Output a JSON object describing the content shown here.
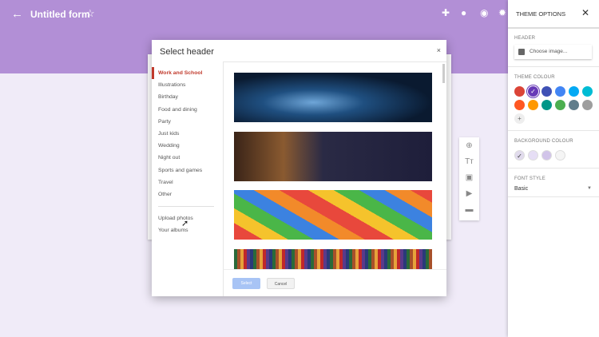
{
  "header": {
    "title": "Untitled form",
    "icons": [
      "back-arrow",
      "star",
      "puzzle",
      "palette",
      "eye",
      "gear"
    ]
  },
  "dialog": {
    "title": "Select header",
    "close": "×",
    "categories": [
      "Work and School",
      "Illustrations",
      "Birthday",
      "Food and dining",
      "Party",
      "Just kids",
      "Wedding",
      "Night out",
      "Sports and games",
      "Travel",
      "Other"
    ],
    "selected": "Work and School",
    "extra": [
      "Upload photos",
      "Your albums"
    ],
    "select_label": "Select",
    "cancel_label": "Cancel"
  },
  "panel": {
    "title": "THEME OPTIONS",
    "close": "✕",
    "header_label": "HEADER",
    "choose_image": "Choose image...",
    "theme_label": "THEME COLOUR",
    "theme_colors": [
      "#db4437",
      "#673ab7",
      "#3f51b5",
      "#4285f4",
      "#03a9f4",
      "#00bcd4",
      "#ff5722",
      "#ff9800",
      "#009688",
      "#4caf50",
      "#607d8b",
      "#9e9e9e"
    ],
    "theme_selected": "#673ab7",
    "background_label": "BACKGROUND COLOUR",
    "background_colors": [
      "#e1dbed",
      "#e6def5",
      "#d1c4e9",
      "#f5f5f5"
    ],
    "font_label": "FONT STYLE",
    "font_value": "Basic"
  }
}
